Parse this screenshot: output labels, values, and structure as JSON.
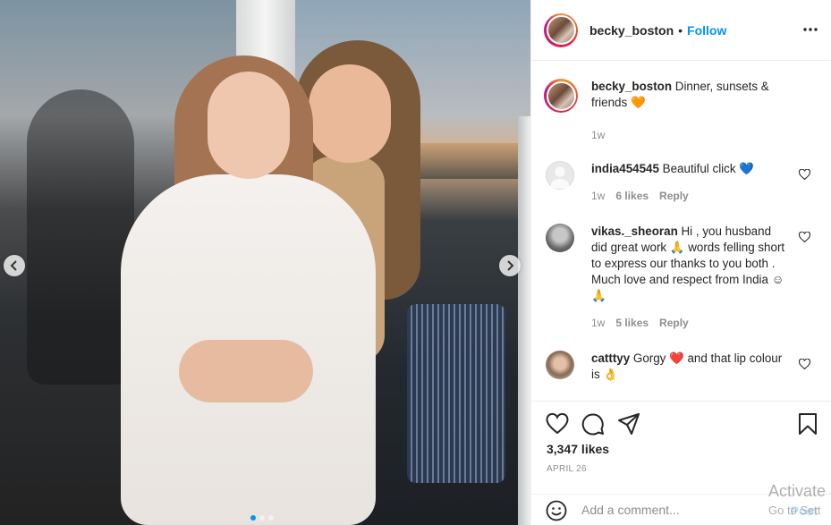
{
  "post": {
    "username": "becky_boston",
    "separator": "•",
    "follow_label": "Follow",
    "caption_text": "Dinner, sunsets & friends",
    "caption_emoji": "🧡",
    "caption_time": "1w",
    "likes": "3,347 likes",
    "date": "APRIL 26"
  },
  "comments": [
    {
      "user": "india454545",
      "text": "Beautiful click",
      "emoji": "💙",
      "time": "1w",
      "likes": "6 likes",
      "reply": "Reply"
    },
    {
      "user": "vikas._sheoran",
      "text": "Hi , you husband did great work 🙏 words felling short to express our thanks to you both . Much love and respect from India ☺🙏",
      "time": "1w",
      "likes": "5 likes",
      "reply": "Reply"
    },
    {
      "user": "catttyy",
      "text": "Gorgy ❤️ and that lip colour is 👌"
    }
  ],
  "add_comment": {
    "placeholder": "Add a comment...",
    "post_label": "Post"
  },
  "watermark": {
    "line1": "Activate",
    "line2": "Go to Sett"
  },
  "icons": {
    "more": "more-horizontal-icon",
    "like": "heart-icon",
    "comment": "comment-icon",
    "share": "share-icon",
    "save": "bookmark-icon",
    "emoji": "smiley-icon",
    "prev": "chevron-left-icon",
    "next": "chevron-right-icon"
  },
  "colors": {
    "accent": "#0095f6",
    "heart_orange": "#f37a1f",
    "heart_blue": "#1ea3f0",
    "heart_red": "#e0245e"
  }
}
